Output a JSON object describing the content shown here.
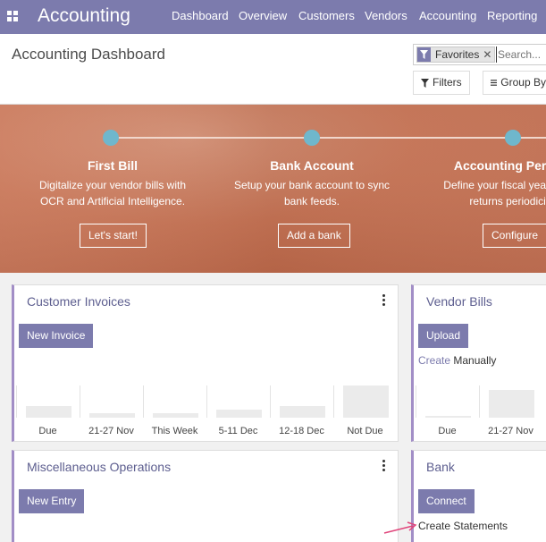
{
  "topbar": {
    "brand": "Accounting",
    "nav": [
      "Dashboard",
      "Overview",
      "Customers",
      "Vendors",
      "Accounting",
      "Reporting"
    ],
    "color": "#7c7bad"
  },
  "control": {
    "title": "Accounting Dashboard",
    "facet_label": "Favorites",
    "search_placeholder": "Search...",
    "filters_label": "Filters",
    "groupby_label": "Group By"
  },
  "banner": {
    "steps": [
      {
        "title": "First Bill",
        "desc1": "Digitalize your vendor bills with",
        "desc2": "OCR and Artificial Intelligence.",
        "button": "Let's start!"
      },
      {
        "title": "Bank Account",
        "desc1": "Setup your bank account to sync",
        "desc2": "bank feeds.",
        "button": "Add a bank"
      },
      {
        "title": "Accounting Periods",
        "desc1": "Define your fiscal years & tax",
        "desc2": "returns periodicity.",
        "button": "Configure"
      }
    ],
    "dot_color": "#6fb7cc"
  },
  "cards": {
    "customer_invoices": {
      "title": "Customer Invoices",
      "button": "New Invoice",
      "graph": {
        "labels": [
          "Due",
          "21-27 Nov",
          "This Week",
          "5-11 Dec",
          "12-18 Dec",
          "Not Due"
        ],
        "values": [
          0.35,
          0.15,
          0.15,
          0.25,
          0.35,
          1.0
        ]
      }
    },
    "vendor_bills": {
      "title": "Vendor Bills",
      "button": "Upload",
      "link_accent": "Create",
      "link_rest": "Manually",
      "graph": {
        "labels": [
          "Due",
          "21-27 Nov"
        ],
        "values": [
          0.05,
          0.85
        ]
      }
    },
    "misc_operations": {
      "title": "Miscellaneous Operations",
      "button": "New Entry"
    },
    "bank": {
      "title": "Bank",
      "button": "Connect",
      "link": "Create Statements"
    }
  },
  "annotation_color": "#e0457b"
}
